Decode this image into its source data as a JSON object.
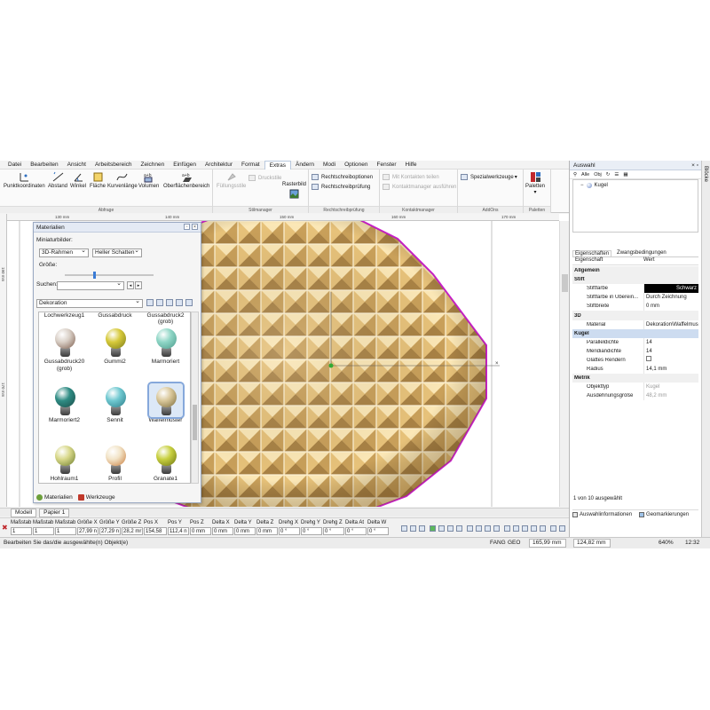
{
  "menu": [
    "Datei",
    "Bearbeiten",
    "Ansicht",
    "Arbeitsbereich",
    "Zeichnen",
    "Einfügen",
    "Architektur",
    "Format",
    "Extras",
    "Ändern",
    "Modi",
    "Optionen",
    "Fenster",
    "Hilfe"
  ],
  "menu_active": "Extras",
  "ribbon": {
    "abfrage": {
      "label": "Abfrage",
      "buttons": [
        "Punktkoordinaten",
        "Abstand",
        "Winkel",
        "Fläche",
        "Kurvenlänge",
        "Volumen",
        "Oberflächenbereich"
      ]
    },
    "stilmanager": {
      "label": "Stilmanager",
      "fuellungsstile": "Füllungsstile",
      "druckstile": "Druckstile",
      "rasterbild": "Rasterbild"
    },
    "rechtschreib": {
      "label": "Rechtschreibprüfung",
      "optionen": "Rechtschreiboptionen",
      "pruefung": "Rechtschreibprüfung"
    },
    "kontakt": {
      "label": "Kontaktmanager",
      "teilen": "Mit Kontakten teilen",
      "ausfuehren": "Kontaktmanager ausführen"
    },
    "addons": {
      "label": "AddOns",
      "spezial": "Spezialwerkzeuge"
    },
    "paletten": {
      "label": "Paletten",
      "button": "Paletten"
    }
  },
  "rulers": {
    "h": [
      "130 mm",
      "140 mm",
      "150 mm",
      "160 mm",
      "170 mm"
    ],
    "v": [
      "190 mm",
      "170 mm"
    ]
  },
  "materials": {
    "title": "Materialien",
    "miniatur_label": "Miniaturbilder:",
    "rahmen": "3D-Rahmen",
    "schatten": "Heller Schatten",
    "groesse_label": "Größe:",
    "suchen_label": "Suchen:",
    "suchen_value": "",
    "kategorie": "Dekoration",
    "size_fraction": 0.33,
    "top_row": [
      "Lochwerkzeug1",
      "Gussabdruck",
      "Gussabdruck2 (grob)"
    ],
    "items": [
      {
        "name": "Gussabdruck20 (grob)",
        "color": "#d9cfc6",
        "dot": "#7a5a4a"
      },
      {
        "name": "Gummi2",
        "color": "#d6c93a",
        "dot": "#7a7a1a"
      },
      {
        "name": "Marmoriert",
        "color": "#8fd6c6",
        "dot": "#4a9a8a"
      },
      {
        "name": "Marmoriert2",
        "color": "#2f8c84",
        "dot": "#1a4a46"
      },
      {
        "name": "Sennit",
        "color": "#6fc8d0",
        "dot": "#2a7a86"
      },
      {
        "name": "Waffelmuster",
        "color": "#d9c79a",
        "dot": "#7a6a3a",
        "selected": true
      },
      {
        "name": "Hohlraum1",
        "color": "#d8d88a",
        "dot": "#6a7a2a"
      },
      {
        "name": "Profil",
        "color": "#f2e4c8",
        "dot": "#c87a3a"
      },
      {
        "name": "Granate1",
        "color": "#c8d040",
        "dot": "#6a7010"
      }
    ],
    "tabs": [
      "Materialien",
      "Werkzeuge"
    ]
  },
  "sheet_tabs": [
    "Modell",
    "Papier 1"
  ],
  "coords": [
    {
      "label": "Maßstab",
      "value": "1"
    },
    {
      "label": "Maßstab",
      "value": "1"
    },
    {
      "label": "Maßstab",
      "value": "1"
    },
    {
      "label": "Größe X",
      "value": "27,99 n"
    },
    {
      "label": "Größe Y",
      "value": "27,29 n"
    },
    {
      "label": "Größe Z",
      "value": "28,2 mr"
    },
    {
      "label": "Pos X",
      "value": "154,58"
    },
    {
      "label": "Pos Y",
      "value": "112,4 n"
    },
    {
      "label": "Pos Z",
      "value": "0 mm"
    },
    {
      "label": "Delta X",
      "value": "0 mm"
    },
    {
      "label": "Delta Y",
      "value": "0 mm"
    },
    {
      "label": "Delta Z",
      "value": "0 mm"
    },
    {
      "label": "Drehg X",
      "value": "0 °"
    },
    {
      "label": "Drehg Y",
      "value": "0 °"
    },
    {
      "label": "Drehg Z",
      "value": "0 °"
    },
    {
      "label": "Delta At",
      "value": "0 °"
    },
    {
      "label": "Delta W",
      "value": "0 °"
    }
  ],
  "status": {
    "message": "Bearbeiten Sie das/die ausgewählte(n) Objekt(e)",
    "fang": "FANG",
    "geo": "GEO",
    "x": "165,99 mm",
    "y": "124,82 mm",
    "zoom": "640%",
    "time": "12:32"
  },
  "selection_panel": {
    "title": "Auswahl",
    "tree_item": "Kugel",
    "toolbar": [
      "Alle",
      "Obj"
    ],
    "tabs": [
      "Eigenschaften",
      "Zwangsbedingungen"
    ],
    "header": [
      "Eigenschaft",
      "Wert"
    ],
    "rows": [
      {
        "type": "cat",
        "k": "Allgemein"
      },
      {
        "type": "cat",
        "k": "Stift"
      },
      {
        "type": "row",
        "k": "Stiftfarbe",
        "v": "Schwarz",
        "style": "black"
      },
      {
        "type": "row",
        "k": "Stiftfarbe in Überein...",
        "v": "Durch Zeichnung"
      },
      {
        "type": "row",
        "k": "Stiftbreite",
        "v": "0 mm"
      },
      {
        "type": "cat",
        "k": "3D"
      },
      {
        "type": "row",
        "k": "Material",
        "v": "Dekoration\\Waffelmus"
      },
      {
        "type": "cat",
        "k": "Kugel",
        "sel": true
      },
      {
        "type": "row",
        "k": "Paralleldichte",
        "v": "14"
      },
      {
        "type": "row",
        "k": "Meridiandichte",
        "v": "14"
      },
      {
        "type": "row",
        "k": "Glattes Rendern",
        "v": ""
      },
      {
        "type": "row",
        "k": "Radius",
        "v": "14,1 mm"
      },
      {
        "type": "cat",
        "k": "Metrik"
      },
      {
        "type": "row",
        "k": "Objekttyp",
        "v": "Kugel",
        "style": "grey"
      },
      {
        "type": "row",
        "k": "Ausdehnungsgröße",
        "v": "48,2 mm",
        "style": "grey"
      }
    ],
    "count": "1 von 10 ausgewählt",
    "bottom": [
      "Auswahlinformationen",
      "Geomarkierungen"
    ]
  },
  "side_tab": "Blöcke"
}
